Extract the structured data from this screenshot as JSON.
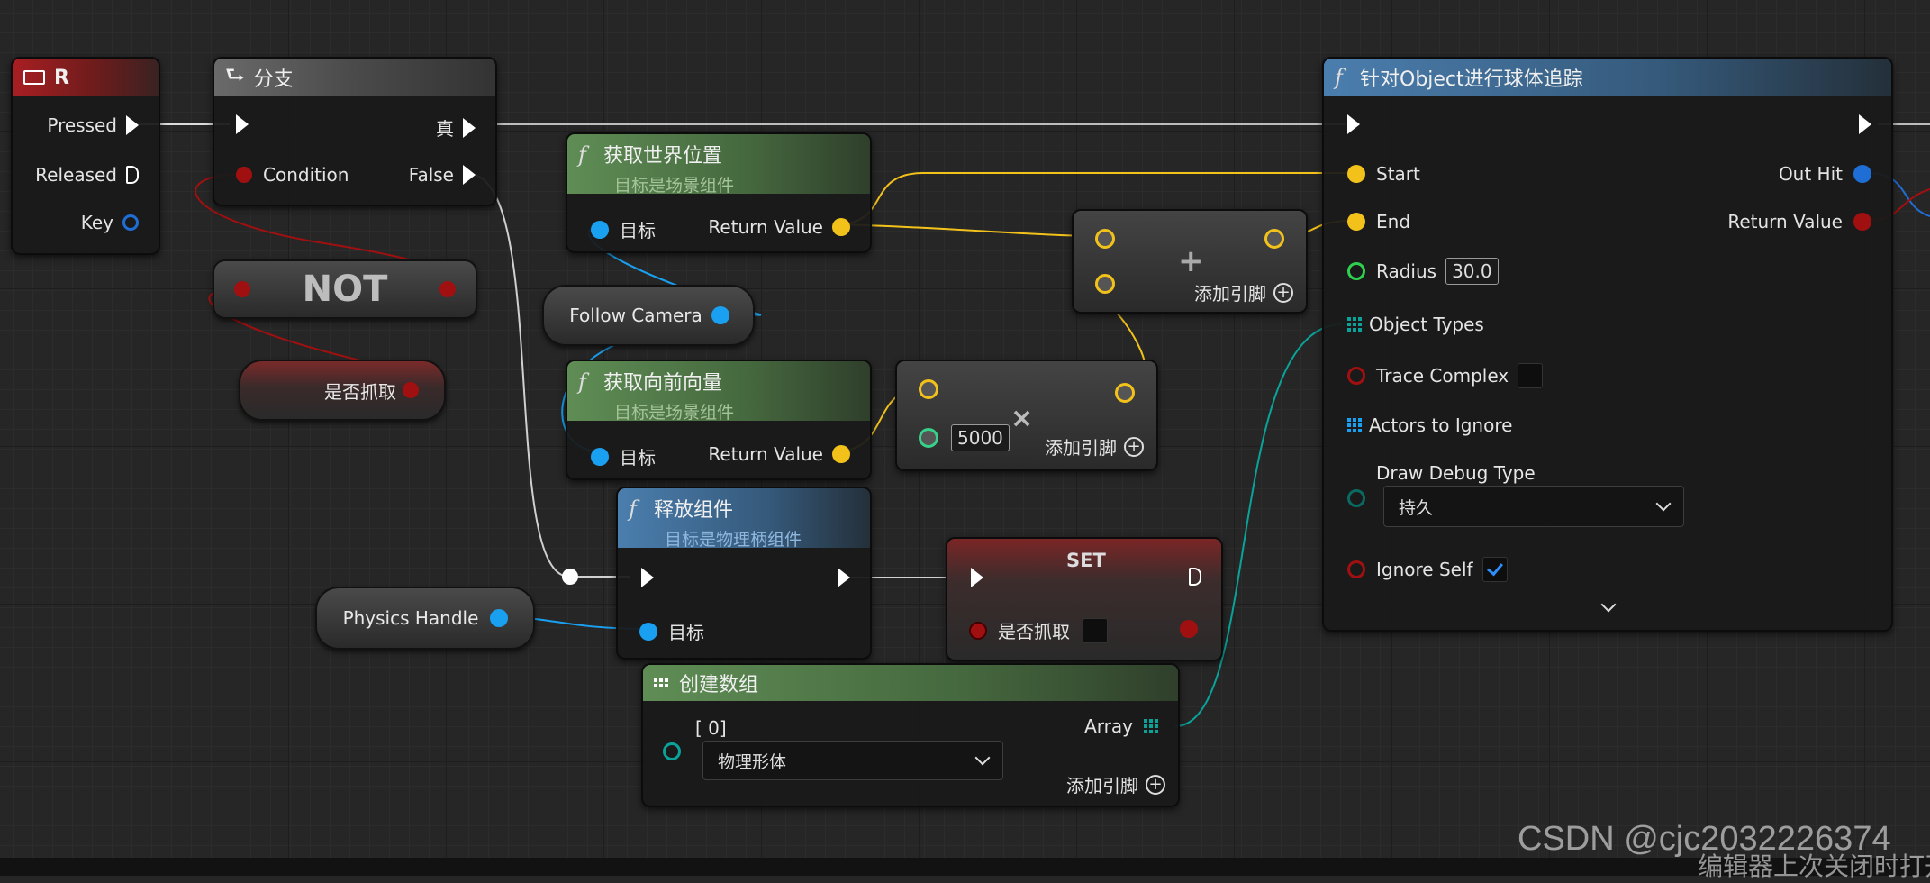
{
  "nodes": {
    "key_r": {
      "title": "R",
      "pressed": "Pressed",
      "released": "Released",
      "key": "Key"
    },
    "branch": {
      "title": "分支",
      "true_label": "真",
      "condition": "Condition",
      "false_label": "False"
    },
    "not_node": {
      "title": "NOT"
    },
    "is_grab_var": {
      "label": "是否抓取"
    },
    "get_world_location": {
      "title": "获取世界位置",
      "subtitle": "目标是场景组件",
      "target": "目标",
      "return_value": "Return Value"
    },
    "follow_camera": {
      "label": "Follow Camera"
    },
    "get_forward_vector": {
      "title": "获取向前向量",
      "subtitle": "目标是场景组件",
      "target": "目标",
      "return_value": "Return Value"
    },
    "add_node": {
      "symbol": "+",
      "add_pin": "添加引脚"
    },
    "multiply_node": {
      "symbol": "×",
      "value": "5000",
      "add_pin": "添加引脚"
    },
    "release_component": {
      "title": "释放组件",
      "subtitle": "目标是物理柄组件",
      "target": "目标"
    },
    "physics_handle": {
      "label": "Physics Handle"
    },
    "set_node": {
      "title": "SET",
      "var": "是否抓取"
    },
    "make_array": {
      "title": "创建数组",
      "index": "[ 0]",
      "selected": "物理形体",
      "array": "Array",
      "add_pin": "添加引脚"
    },
    "sphere_trace": {
      "title": "针对Object进行球体追踪",
      "start": "Start",
      "end": "End",
      "radius": "Radius",
      "radius_value": "30.0",
      "object_types": "Object Types",
      "trace_complex": "Trace Complex",
      "actors_to_ignore": "Actors to Ignore",
      "draw_debug_type": "Draw Debug Type",
      "draw_debug_value": "持久",
      "ignore_self": "Ignore Self",
      "out_hit": "Out Hit",
      "return_value": "Return Value"
    }
  },
  "watermark": {
    "csdn": "CSDN @cjc2032226374",
    "overlay": "编辑器上次关闭时打开"
  },
  "colors": {
    "exec": "#ffffff",
    "bool": "#a01010",
    "object": "#1aa0f0",
    "vector": "#f2c21b",
    "float": "#37d18a",
    "int": "#2fd04f",
    "array_struct": "#0aa39a"
  }
}
